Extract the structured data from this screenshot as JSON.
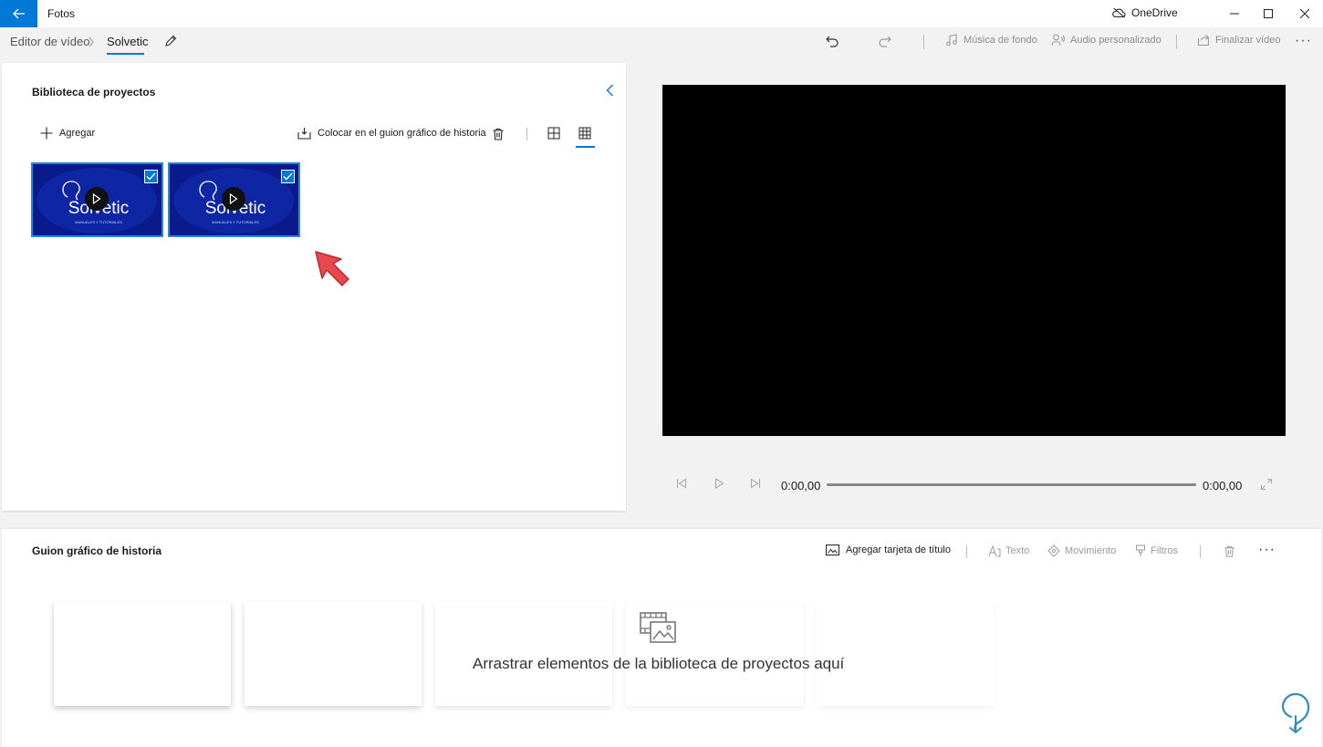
{
  "window": {
    "app_title": "Fotos",
    "cloud_label": "OneDrive"
  },
  "breadcrumb": {
    "root": "Editor de vídeo",
    "current": "Solvetic"
  },
  "toolbar": {
    "background_music": "Música de fondo",
    "custom_audio": "Audio personalizado",
    "finish_video": "Finalizar vídeo",
    "more": "···"
  },
  "library": {
    "title": "Biblioteca de proyectos",
    "add_label": "Agregar",
    "place_label": "Colocar en el guion gráfico de historia",
    "items": [
      {
        "brand_text": "Solvetic",
        "caption": "MANUALES Y TUTORIALES",
        "selected": true
      },
      {
        "brand_text": "Solvetic",
        "caption": "MANUALES Y TUTORIALES",
        "selected": true
      }
    ]
  },
  "preview": {
    "current_time": "0:00,00",
    "total_time": "0:00,00"
  },
  "storyboard": {
    "title": "Guion gráfico de historia",
    "add_title_card": "Agregar tarjeta de título",
    "text_label": "Texto",
    "motion_label": "Movimiento",
    "filters_label": "Filtros",
    "more": "···",
    "drop_hint": "Arrastrar elementos de la biblioteca de proyectos aquí"
  },
  "colors": {
    "accent": "#0078d7",
    "thumb_bg": "#0a1a8a",
    "pointer": "#e8484e"
  },
  "icons": {
    "back": "back-arrow-icon",
    "onedrive": "cloud-off-icon",
    "edit": "pencil-icon",
    "undo": "undo-icon",
    "redo": "redo-icon",
    "music": "music-note-icon",
    "audio": "person-voice-icon",
    "export": "share-icon"
  }
}
